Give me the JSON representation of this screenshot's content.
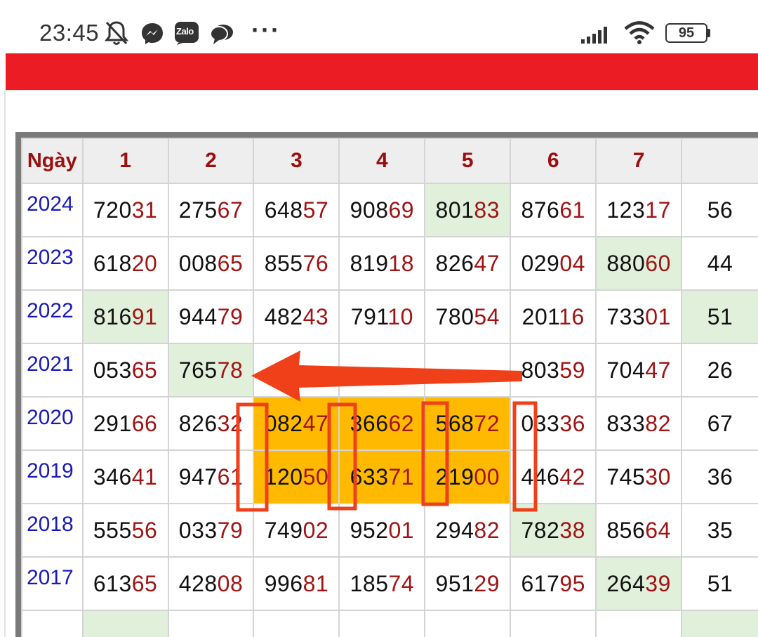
{
  "status_bar": {
    "time": "23:45",
    "icons": [
      "bell-off-icon",
      "messenger-icon",
      "zalo-icon",
      "chat-icon",
      "more-icon"
    ],
    "zalo_label": "Zalo",
    "more": "···",
    "battery": "95"
  },
  "table": {
    "headers": [
      "Ngày",
      "1",
      "2",
      "3",
      "4",
      "5",
      "6",
      "7",
      ""
    ],
    "rows": [
      {
        "year": "2024",
        "cells": [
          {
            "head": "720",
            "tail": "31",
            "hl": ""
          },
          {
            "head": "275",
            "tail": "67",
            "hl": ""
          },
          {
            "head": "648",
            "tail": "57",
            "hl": ""
          },
          {
            "head": "908",
            "tail": "69",
            "hl": ""
          },
          {
            "head": "801",
            "tail": "83",
            "hl": "green"
          },
          {
            "head": "876",
            "tail": "61",
            "hl": ""
          },
          {
            "head": "123",
            "tail": "17",
            "hl": ""
          },
          {
            "head": "56",
            "tail": "",
            "hl": ""
          }
        ]
      },
      {
        "year": "2023",
        "cells": [
          {
            "head": "618",
            "tail": "20",
            "hl": ""
          },
          {
            "head": "008",
            "tail": "65",
            "hl": ""
          },
          {
            "head": "855",
            "tail": "76",
            "hl": ""
          },
          {
            "head": "819",
            "tail": "18",
            "hl": ""
          },
          {
            "head": "826",
            "tail": "47",
            "hl": ""
          },
          {
            "head": "029",
            "tail": "04",
            "hl": ""
          },
          {
            "head": "880",
            "tail": "60",
            "hl": "green"
          },
          {
            "head": "44",
            "tail": "",
            "hl": ""
          }
        ]
      },
      {
        "year": "2022",
        "cells": [
          {
            "head": "816",
            "tail": "91",
            "hl": "green"
          },
          {
            "head": "944",
            "tail": "79",
            "hl": ""
          },
          {
            "head": "482",
            "tail": "43",
            "hl": ""
          },
          {
            "head": "791",
            "tail": "10",
            "hl": ""
          },
          {
            "head": "780",
            "tail": "54",
            "hl": ""
          },
          {
            "head": "201",
            "tail": "16",
            "hl": ""
          },
          {
            "head": "733",
            "tail": "01",
            "hl": ""
          },
          {
            "head": "51",
            "tail": "",
            "hl": "green"
          }
        ]
      },
      {
        "year": "2021",
        "cells": [
          {
            "head": "053",
            "tail": "65",
            "hl": ""
          },
          {
            "head": "765",
            "tail": "78",
            "hl": "green"
          },
          {
            "head": "",
            "tail": "",
            "hl": ""
          },
          {
            "head": "",
            "tail": "",
            "hl": ""
          },
          {
            "head": "",
            "tail": "",
            "hl": ""
          },
          {
            "head": "803",
            "tail": "59",
            "hl": ""
          },
          {
            "head": "704",
            "tail": "47",
            "hl": ""
          },
          {
            "head": "26",
            "tail": "",
            "hl": ""
          }
        ]
      },
      {
        "year": "2020",
        "cells": [
          {
            "head": "291",
            "tail": "66",
            "hl": ""
          },
          {
            "head": "826",
            "tail": "32",
            "hl": ""
          },
          {
            "head": "082",
            "tail": "47",
            "hl": "yellow"
          },
          {
            "head": "366",
            "tail": "62",
            "hl": "yellow"
          },
          {
            "head": "568",
            "tail": "72",
            "hl": "yellow"
          },
          {
            "head": "033",
            "tail": "36",
            "hl": ""
          },
          {
            "head": "833",
            "tail": "82",
            "hl": ""
          },
          {
            "head": "67",
            "tail": "",
            "hl": ""
          }
        ]
      },
      {
        "year": "2019",
        "cells": [
          {
            "head": "346",
            "tail": "41",
            "hl": ""
          },
          {
            "head": "947",
            "tail": "61",
            "hl": ""
          },
          {
            "head": "120",
            "tail": "50",
            "hl": "yellow"
          },
          {
            "head": "633",
            "tail": "71",
            "hl": "yellow"
          },
          {
            "head": "219",
            "tail": "00",
            "hl": "yellow"
          },
          {
            "head": "446",
            "tail": "42",
            "hl": ""
          },
          {
            "head": "745",
            "tail": "30",
            "hl": ""
          },
          {
            "head": "36",
            "tail": "",
            "hl": ""
          }
        ]
      },
      {
        "year": "2018",
        "cells": [
          {
            "head": "555",
            "tail": "56",
            "hl": ""
          },
          {
            "head": "033",
            "tail": "79",
            "hl": ""
          },
          {
            "head": "749",
            "tail": "02",
            "hl": ""
          },
          {
            "head": "952",
            "tail": "01",
            "hl": ""
          },
          {
            "head": "294",
            "tail": "82",
            "hl": ""
          },
          {
            "head": "782",
            "tail": "38",
            "hl": "green"
          },
          {
            "head": "856",
            "tail": "64",
            "hl": ""
          },
          {
            "head": "35",
            "tail": "",
            "hl": ""
          }
        ]
      },
      {
        "year": "2017",
        "cells": [
          {
            "head": "613",
            "tail": "65",
            "hl": ""
          },
          {
            "head": "428",
            "tail": "08",
            "hl": ""
          },
          {
            "head": "996",
            "tail": "81",
            "hl": ""
          },
          {
            "head": "185",
            "tail": "74",
            "hl": ""
          },
          {
            "head": "951",
            "tail": "29",
            "hl": ""
          },
          {
            "head": "617",
            "tail": "95",
            "hl": ""
          },
          {
            "head": "264",
            "tail": "39",
            "hl": "green"
          },
          {
            "head": "51",
            "tail": "",
            "hl": ""
          }
        ]
      },
      {
        "year": "",
        "cells": [
          {
            "head": "",
            "tail": "",
            "hl": "green"
          },
          {
            "head": "",
            "tail": "",
            "hl": ""
          },
          {
            "head": "",
            "tail": "",
            "hl": ""
          },
          {
            "head": "",
            "tail": "",
            "hl": ""
          },
          {
            "head": "",
            "tail": "",
            "hl": ""
          },
          {
            "head": "",
            "tail": "",
            "hl": ""
          },
          {
            "head": "",
            "tail": "",
            "hl": ""
          },
          {
            "head": "",
            "tail": "",
            "hl": "green"
          }
        ]
      }
    ]
  },
  "colors": {
    "accent_red": "#ec1c24",
    "header_text": "#9b0f0f",
    "year_text": "#1a1ab8",
    "tail_text": "#a01414",
    "highlight_green": "#e0f0db",
    "highlight_yellow": "#ffba00",
    "annotation": "#f0401a"
  }
}
